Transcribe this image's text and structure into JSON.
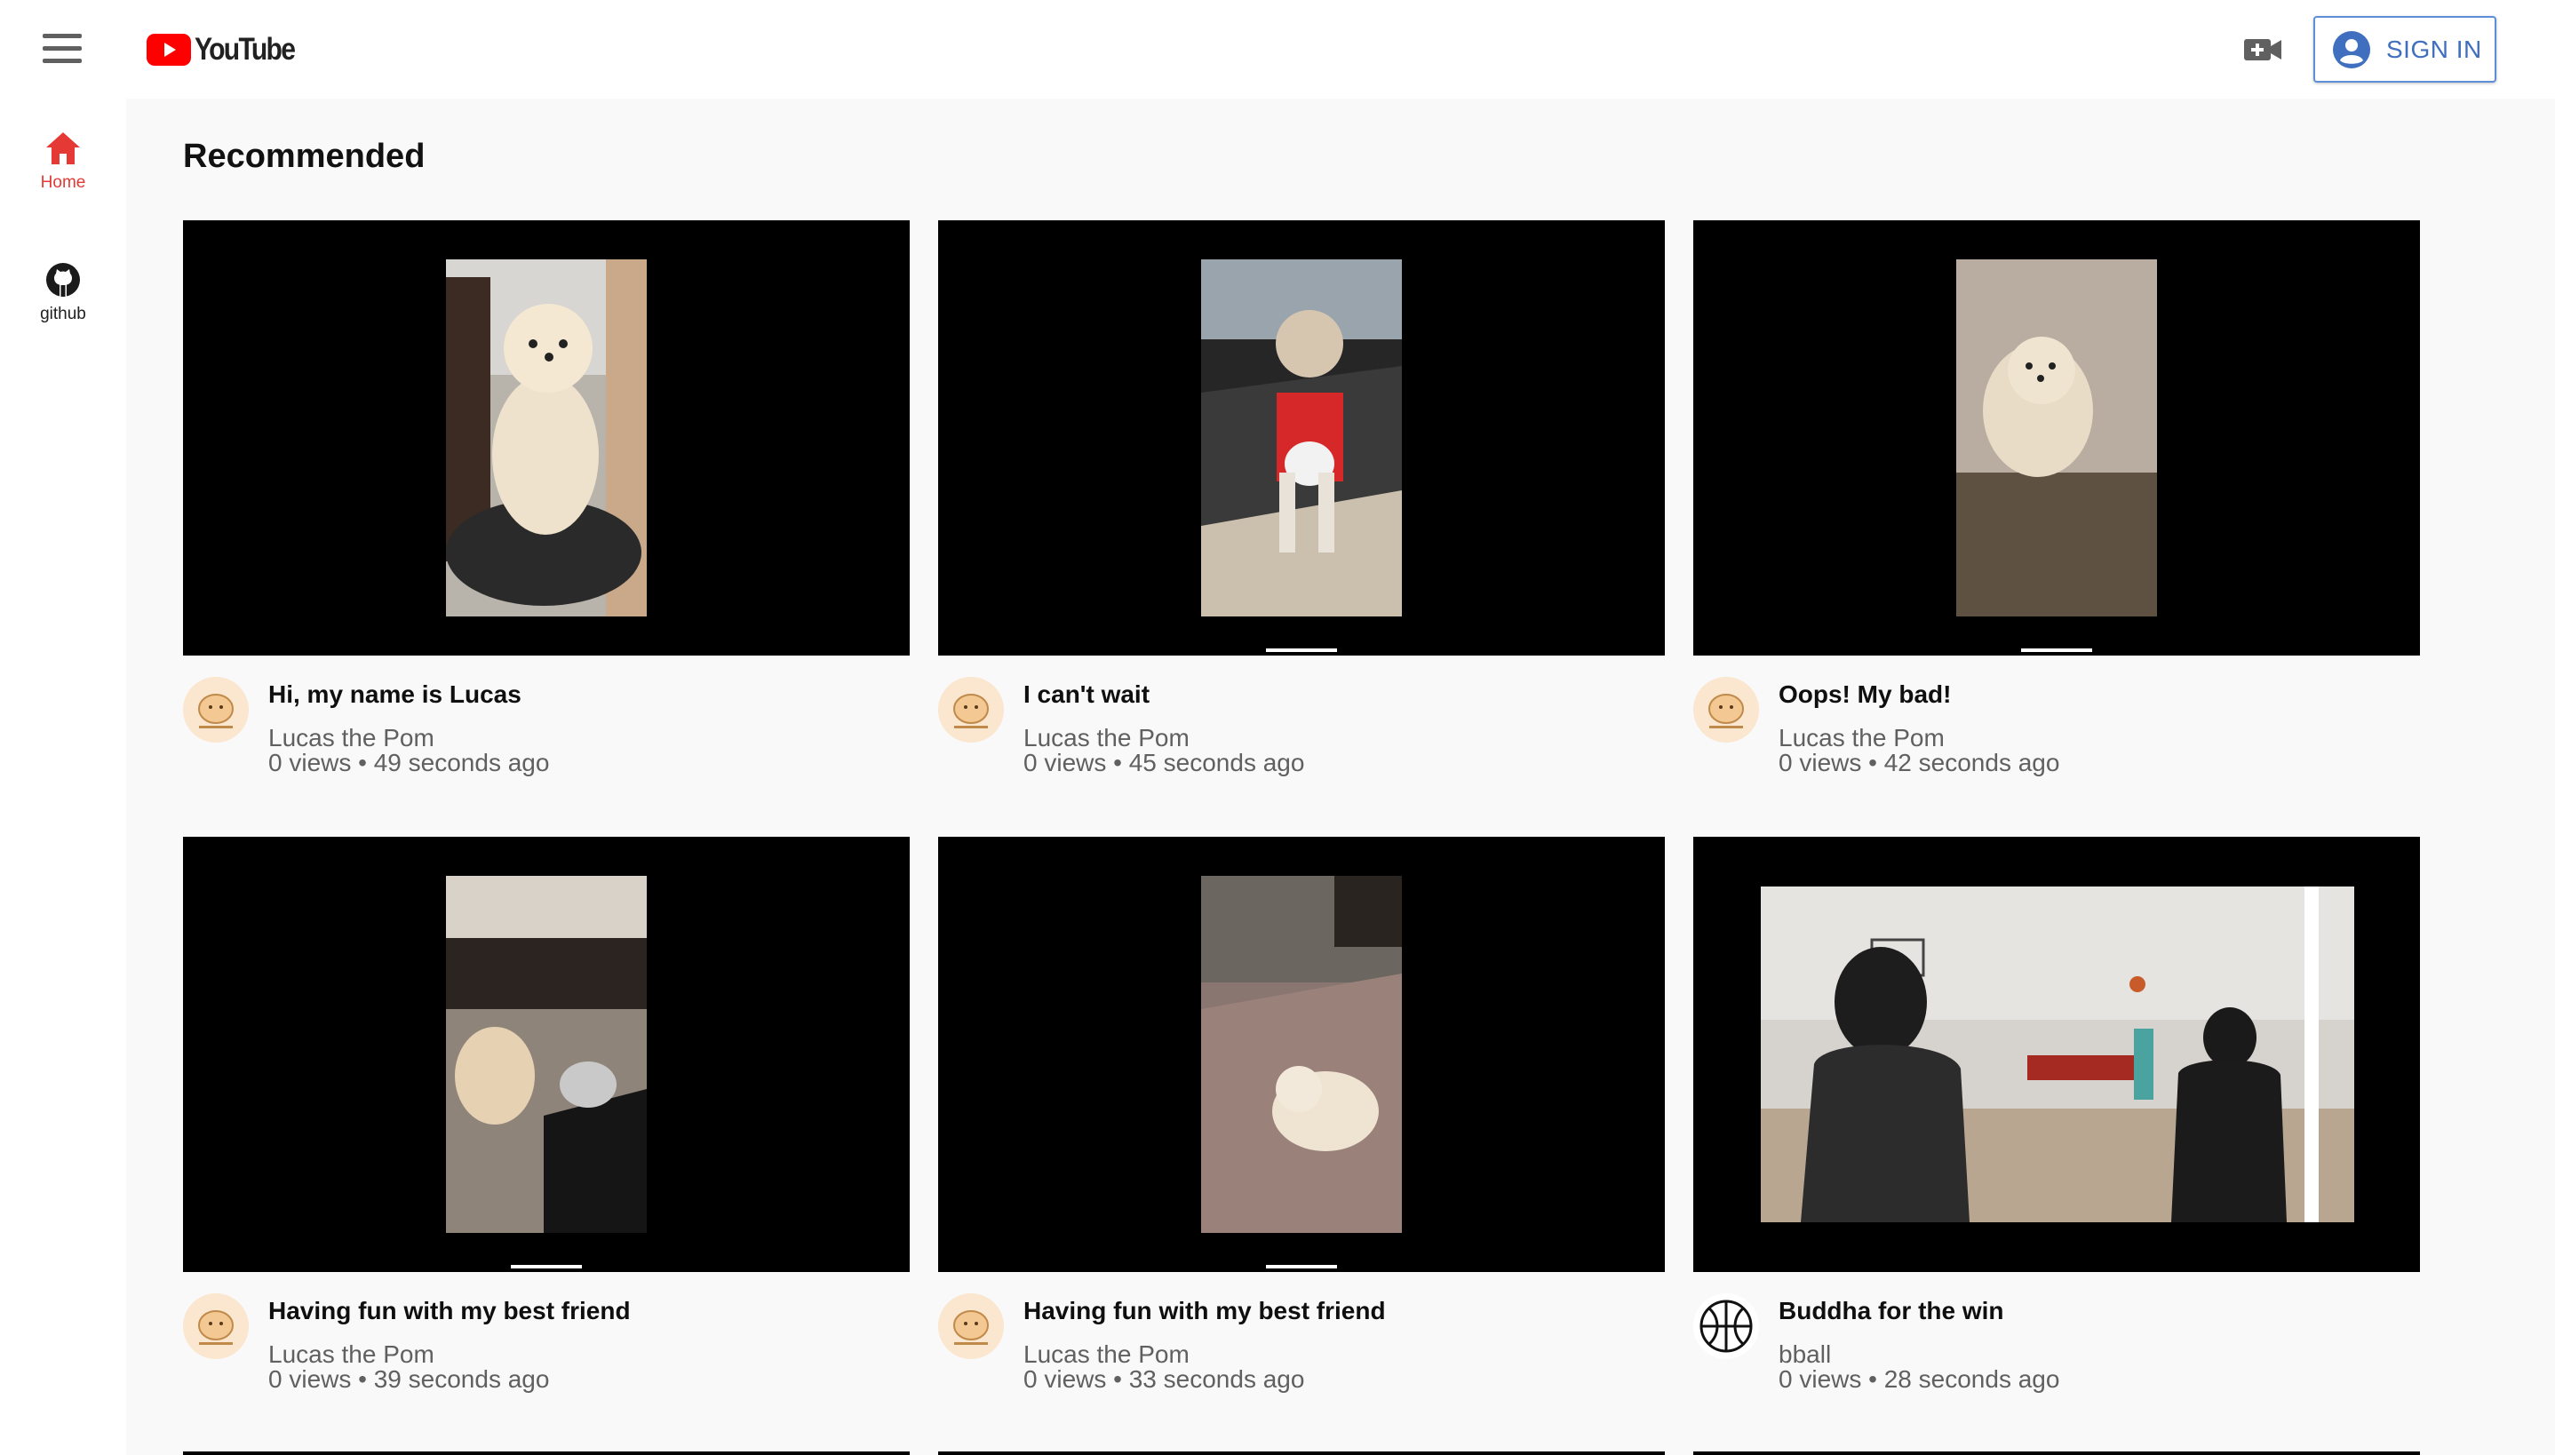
{
  "header": {
    "logo_text": "YouTube",
    "sign_in_label": "SIGN IN"
  },
  "sidebar": {
    "items": [
      {
        "label": "Home",
        "icon": "home-icon",
        "active": true
      },
      {
        "label": "github",
        "icon": "github-icon",
        "active": false
      }
    ]
  },
  "main": {
    "section_title": "Recommended",
    "videos": [
      {
        "title": "Hi, my name is Lucas",
        "channel": "Lucas the Pom",
        "meta": "0 views • 49 seconds ago"
      },
      {
        "title": "I can't wait",
        "channel": "Lucas the Pom",
        "meta": "0 views • 45 seconds ago"
      },
      {
        "title": "Oops! My bad!",
        "channel": "Lucas the Pom",
        "meta": "0 views • 42 seconds ago"
      },
      {
        "title": "Having fun with my best friend",
        "channel": "Lucas the Pom",
        "meta": "0 views • 39 seconds ago"
      },
      {
        "title": "Having fun with my best friend",
        "channel": "Lucas the Pom",
        "meta": "0 views • 33 seconds ago"
      },
      {
        "title": "Buddha for the win",
        "channel": "bball",
        "meta": "0 views • 28 seconds ago"
      }
    ]
  },
  "colors": {
    "brand_red": "#ff0000",
    "active_nav": "#e53935",
    "sign_in_blue": "#3f6fbe",
    "page_bg": "#f9f9f9"
  }
}
